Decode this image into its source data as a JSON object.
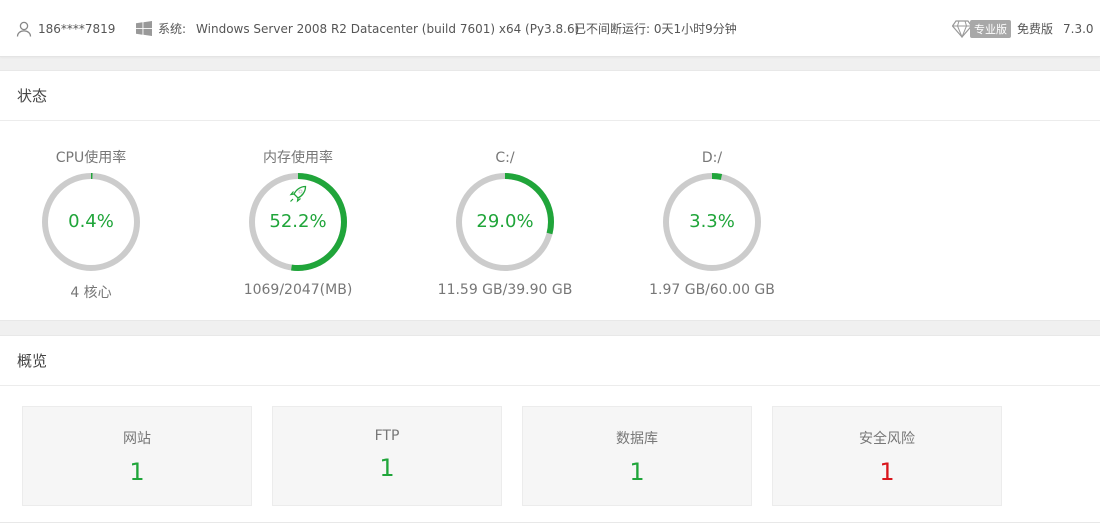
{
  "topbar": {
    "user": "186****7819",
    "system_label": "系统:",
    "system_value": "Windows Server 2008 R2 Datacenter (build 7601) x64 (Py3.8.6)",
    "uptime": "已不间断运行: 0天1小时9分钟",
    "pro_label": "专业版",
    "free_label": "免费版",
    "version": "7.3.0"
  },
  "status": {
    "title": "状态",
    "gauges": [
      {
        "title": "CPU使用率",
        "percent_text": "0.4%",
        "percent": 0.4,
        "sub": "4 核心"
      },
      {
        "title": "内存使用率",
        "percent_text": "52.2%",
        "percent": 52.2,
        "sub": "1069/2047(MB)"
      },
      {
        "title": "C:/",
        "percent_text": "29.0%",
        "percent": 29.0,
        "sub": "11.59 GB/39.90 GB"
      },
      {
        "title": "D:/",
        "percent_text": "3.3%",
        "percent": 3.3,
        "sub": "1.97 GB/60.00 GB"
      }
    ]
  },
  "overview": {
    "title": "概览",
    "cards": [
      {
        "label": "网站",
        "value": "1"
      },
      {
        "label": "FTP",
        "value": "1"
      },
      {
        "label": "数据库",
        "value": "1"
      },
      {
        "label": "安全风险",
        "value": "1"
      }
    ]
  },
  "colors": {
    "accent": "#20a53a",
    "track": "#cccccc",
    "danger": "#d9161c"
  },
  "icons": [
    "user-icon",
    "windows-icon",
    "diamond-icon",
    "rocket-icon"
  ]
}
